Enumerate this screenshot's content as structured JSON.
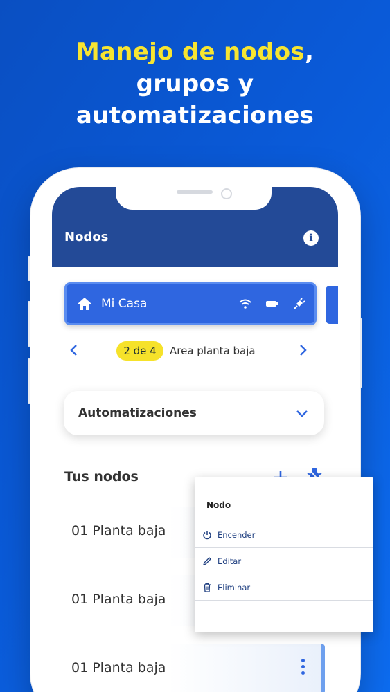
{
  "headline": {
    "line1": "Manejo de nodos",
    "line1_suffix": ",",
    "line2": "grupos y",
    "line3": "automatizaciones"
  },
  "app": {
    "title": "Nodos",
    "house": {
      "name": "Mi Casa",
      "icons": [
        "wifi-icon",
        "battery-icon",
        "plug-icon"
      ]
    },
    "pager": {
      "badge": "2 de 4",
      "area": "Area planta baja"
    },
    "automations": {
      "label": "Automatizaciones"
    },
    "section": {
      "title": "Tus nodos"
    },
    "nodes": [
      {
        "label": "01 Planta baja"
      },
      {
        "label": "01 Planta baja"
      },
      {
        "label": "01 Planta baja"
      }
    ]
  },
  "menu": {
    "title": "Nodo",
    "items": [
      {
        "label": "Encender",
        "icon": "power-icon"
      },
      {
        "label": "Editar",
        "icon": "pencil-icon"
      },
      {
        "label": "Eliminar",
        "icon": "trash-icon"
      }
    ]
  },
  "colors": {
    "background": "#0a5ad8",
    "accent_yellow": "#f7e531",
    "appbar": "#234a97",
    "primary": "#2f66e0"
  }
}
